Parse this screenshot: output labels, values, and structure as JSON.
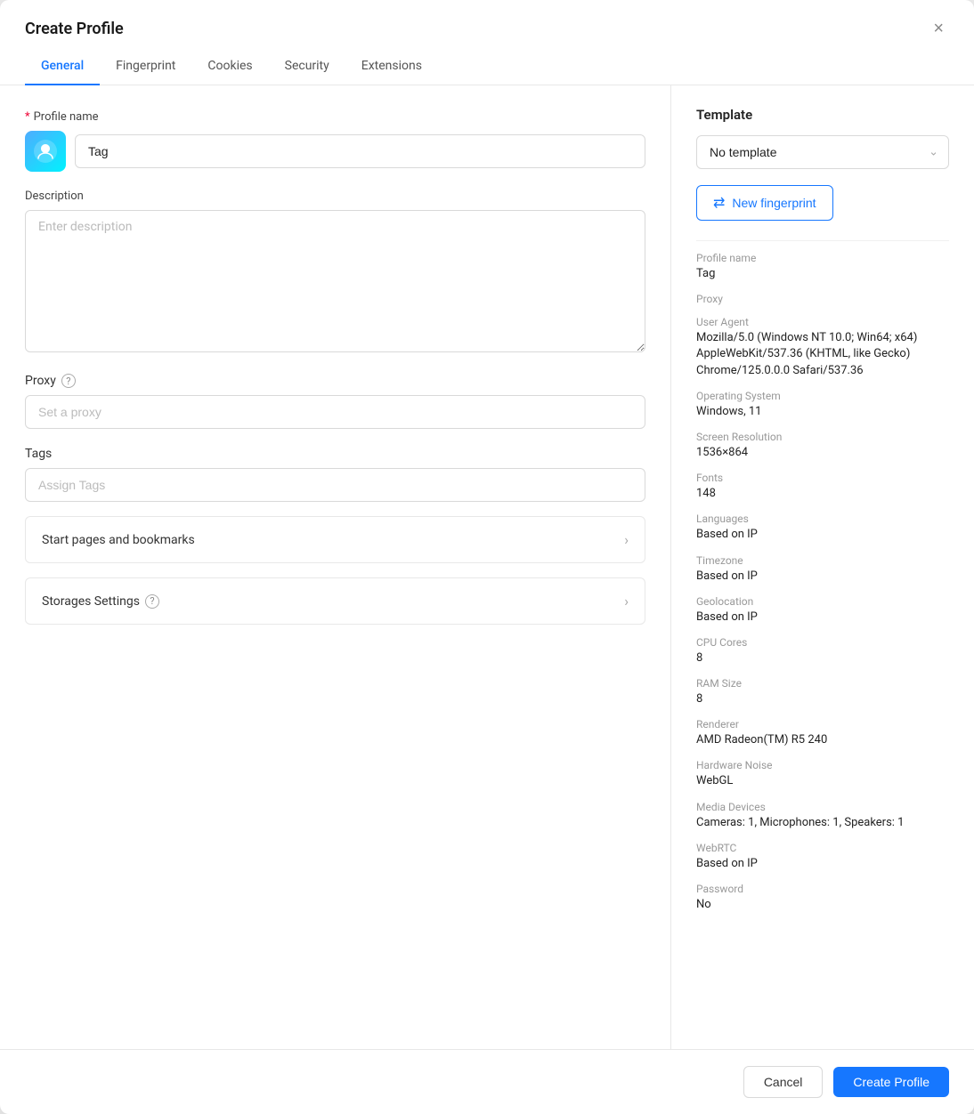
{
  "modal": {
    "title": "Create Profile",
    "close_label": "×"
  },
  "tabs": [
    {
      "label": "General",
      "active": true
    },
    {
      "label": "Fingerprint",
      "active": false
    },
    {
      "label": "Cookies",
      "active": false
    },
    {
      "label": "Security",
      "active": false
    },
    {
      "label": "Extensions",
      "active": false
    }
  ],
  "left": {
    "profile_name_label": "Profile name",
    "profile_name_required": "*",
    "profile_name_value": "Tag",
    "description_label": "Description",
    "description_placeholder": "Enter description",
    "proxy_label": "Proxy",
    "proxy_placeholder": "Set a proxy",
    "tags_label": "Tags",
    "tags_placeholder": "Assign Tags",
    "start_pages_label": "Start pages and bookmarks",
    "storages_label": "Storages Settings"
  },
  "right": {
    "template_label": "Template",
    "template_value": "No template",
    "new_fingerprint_label": "New fingerprint",
    "fingerprint_icon": "⇄",
    "profile_name_key": "Profile name",
    "profile_name_val": "Tag",
    "proxy_key": "Proxy",
    "proxy_val": "",
    "user_agent_key": "User Agent",
    "user_agent_val": "Mozilla/5.0 (Windows NT 10.0; Win64; x64) AppleWebKit/537.36 (KHTML, like Gecko) Chrome/125.0.0.0 Safari/537.36",
    "os_key": "Operating System",
    "os_val": "Windows, 11",
    "screen_key": "Screen Resolution",
    "screen_val": "1536×864",
    "fonts_key": "Fonts",
    "fonts_val": "148",
    "languages_key": "Languages",
    "languages_val": "Based on IP",
    "timezone_key": "Timezone",
    "timezone_val": "Based on IP",
    "geolocation_key": "Geolocation",
    "geolocation_val": "Based on IP",
    "cpu_key": "CPU Cores",
    "cpu_val": "8",
    "ram_key": "RAM Size",
    "ram_val": "8",
    "renderer_key": "Renderer",
    "renderer_val": "AMD Radeon(TM) R5 240",
    "hardware_noise_key": "Hardware Noise",
    "hardware_noise_val": "WebGL",
    "media_devices_key": "Media Devices",
    "media_devices_val": "Cameras: 1, Microphones: 1, Speakers: 1",
    "webrtc_key": "WebRTC",
    "webrtc_val": "Based on IP",
    "password_key": "Password",
    "password_val": "No"
  },
  "footer": {
    "cancel_label": "Cancel",
    "create_label": "Create Profile"
  }
}
